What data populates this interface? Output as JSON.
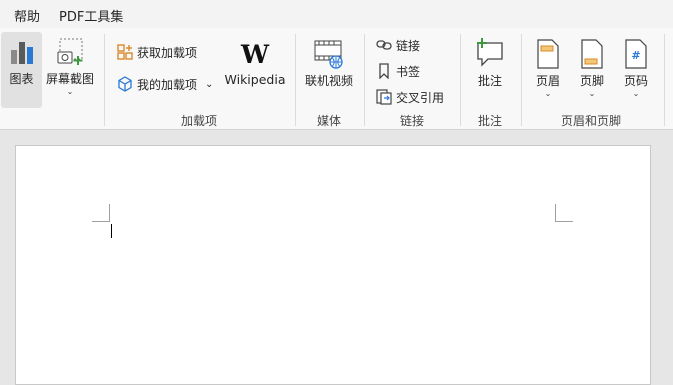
{
  "menu": {
    "help": "帮助",
    "pdf_tools": "PDF工具集"
  },
  "ribbon": {
    "chart": "图表",
    "screenshot": "屏幕截图",
    "get_addins": "获取加载项",
    "my_addins": "我的加载项",
    "wikipedia": "Wikipedia",
    "online_video": "联机视频",
    "link": "链接",
    "bookmark": "书签",
    "cross_ref": "交叉引用",
    "comment": "批注",
    "header": "页眉",
    "footer": "页脚",
    "page_number": "页码",
    "chevron": "⌄"
  },
  "groups": {
    "addins": "加载项",
    "media": "媒体",
    "links": "链接",
    "comments": "批注",
    "header_footer": "页眉和页脚"
  },
  "colors": {
    "accent_blue": "#2b79d6",
    "green": "#3b9a3f",
    "orange": "#d9892b"
  }
}
